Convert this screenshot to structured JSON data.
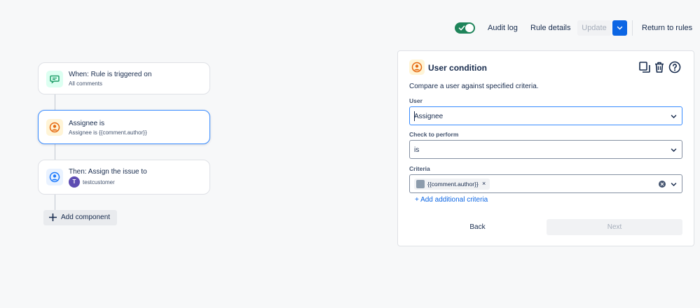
{
  "toolbar": {
    "toggle_on": true,
    "audit_log": "Audit log",
    "rule_details": "Rule details",
    "update": "Update",
    "return_to_rules": "Return to rules"
  },
  "flow": {
    "trigger": {
      "title": "When: Rule is triggered on",
      "subtitle": "All comments",
      "icon": "comment-icon",
      "color": "#22a06b"
    },
    "condition": {
      "title": "Assignee is",
      "subtitle": "Assignee is {{comment.author}}",
      "icon": "user-icon",
      "color": "#e56910"
    },
    "action": {
      "title": "Then: Assign the issue to",
      "avatar_initial": "T",
      "assignee": "testcustomer",
      "icon": "user-icon",
      "color": "#1d7afc"
    },
    "add_component": "Add component"
  },
  "panel": {
    "title": "User condition",
    "description": "Compare a user against specified criteria.",
    "user_label": "User",
    "user_value": "Assignee",
    "check_label": "Check to perform",
    "check_value": "is",
    "criteria_label": "Criteria",
    "criteria_chip": "{{comment.author}}",
    "chip_remove": "×",
    "add_criteria": "+ Add additional criteria",
    "back": "Back",
    "next": "Next"
  },
  "colors": {
    "accent": "#0c66e4",
    "toggle": "#1f845a"
  }
}
